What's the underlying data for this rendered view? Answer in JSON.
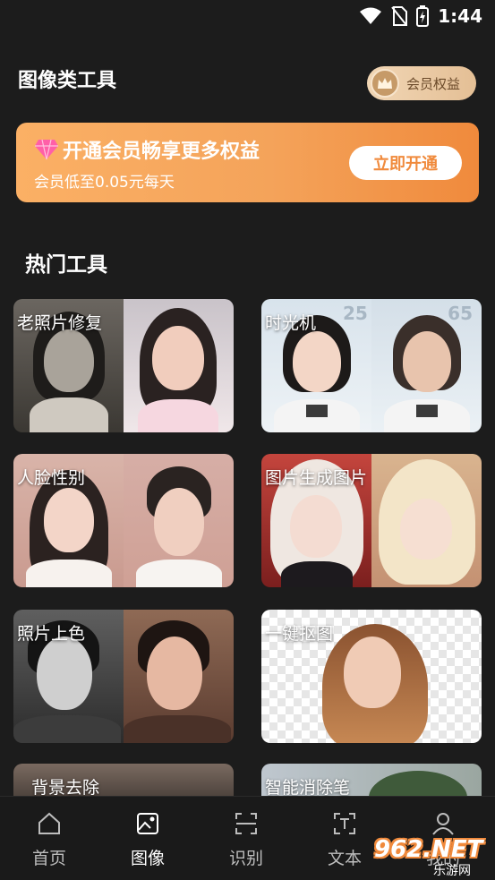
{
  "status_bar": {
    "time": "1:44"
  },
  "header": {
    "title": "图像类工具",
    "vip_label": "会员权益"
  },
  "banner": {
    "title": "开通会员畅享更多权益",
    "subtitle": "会员低至0.05元每天",
    "button": "立即开通"
  },
  "section": {
    "title": "热门工具"
  },
  "tools": [
    {
      "label": "老照片修复"
    },
    {
      "label": "时光机",
      "age_left": "25",
      "age_right": "65"
    },
    {
      "label": "人脸性别"
    },
    {
      "label": "图片生成图片"
    },
    {
      "label": "照片上色"
    },
    {
      "label": "一键抠图"
    },
    {
      "label": "背景去除"
    },
    {
      "label": "智能消除笔"
    }
  ],
  "tab_bar": {
    "items": [
      {
        "label": "首页",
        "icon": "home-icon"
      },
      {
        "label": "图像",
        "icon": "image-icon"
      },
      {
        "label": "识别",
        "icon": "scan-icon"
      },
      {
        "label": "文本",
        "icon": "text-icon"
      },
      {
        "label": "我的",
        "icon": "profile-icon"
      }
    ],
    "active_index": 1
  },
  "watermark": {
    "text": "962.NET",
    "subtext": "乐游网"
  },
  "colors": {
    "accent": "#f08a3c",
    "background": "#1c1c1c",
    "vip_gold": "#e4bf95"
  }
}
